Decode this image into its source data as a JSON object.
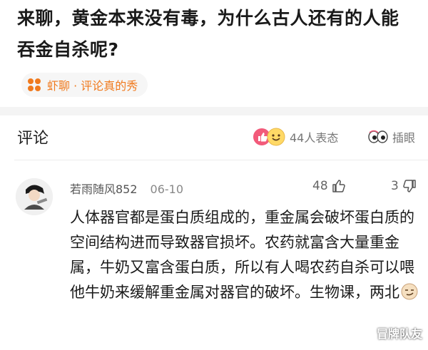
{
  "question": {
    "title": "来聊，黄金本来没有毒，为什么古人还有的人能吞金自杀呢?"
  },
  "circle": {
    "icon": "circle-dots-icon",
    "label": "虾聊 · 评论真的秀"
  },
  "comments_header": {
    "title": "评论",
    "reaction_count": "44人表态",
    "insert_eye_label": "插眼",
    "icons": [
      "thumbs-up-emoji-icon",
      "smile-emoji-icon",
      "eyes-icon"
    ]
  },
  "comment": {
    "username": "若雨随风852",
    "date": "06-10",
    "likes": "48",
    "dislikes": "3",
    "text": "人体器官都是蛋白质组成的，重金属会破坏蛋白质的空间结构进而导致器官损坏。农药就富含大量重金属，牛奶又富含蛋白质，所以有人喝农药自杀可以喂他牛奶来缓解重金属对器官的破坏。生物课，两北",
    "trailing_icon": "smirk-emoji-icon"
  },
  "watermark": {
    "text": "冒牌队友"
  },
  "colors": {
    "accent_orange": "#f07a1e",
    "reaction_pink": "#f25a7a",
    "emoji_yellow": "#ffd966"
  }
}
